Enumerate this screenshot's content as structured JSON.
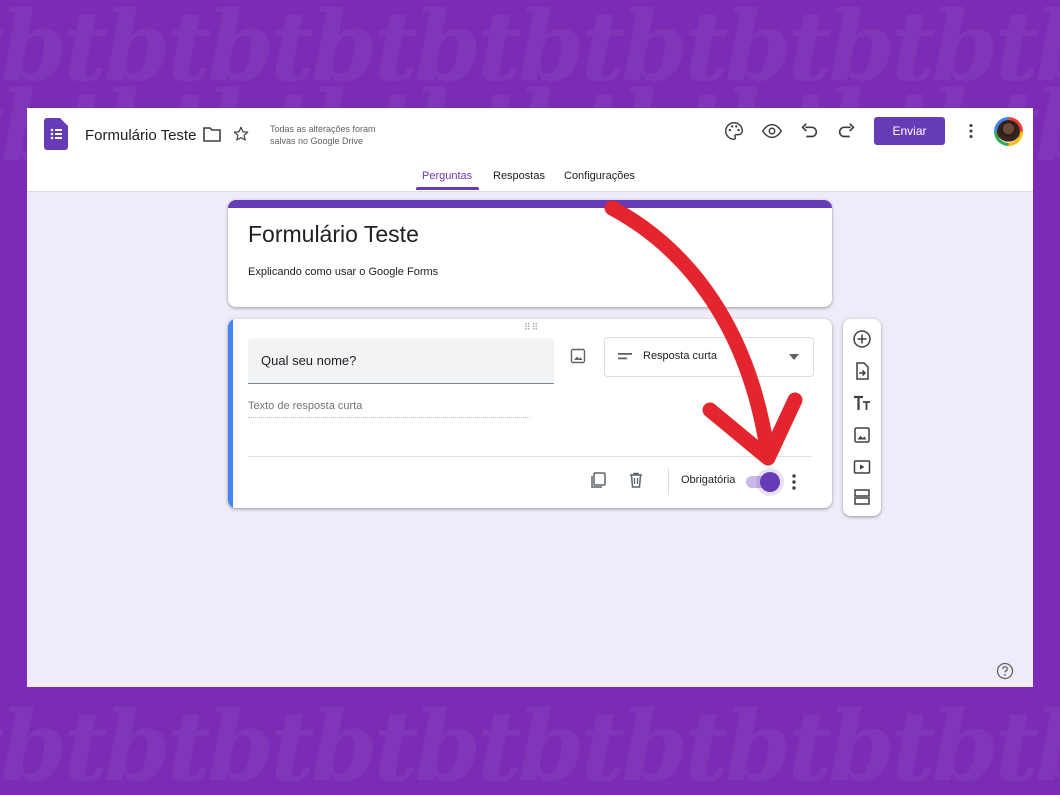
{
  "app": {
    "doc_title": "Formulário Teste",
    "save_status_line1": "Todas as alterações foram",
    "save_status_line2": "salvas no Google Drive",
    "send_label": "Enviar"
  },
  "tabs": [
    {
      "label": "Perguntas",
      "active": true
    },
    {
      "label": "Respostas",
      "active": false
    },
    {
      "label": "Configurações",
      "active": false
    }
  ],
  "form": {
    "title": "Formulário Teste",
    "description": "Explicando como usar o Google Forms"
  },
  "question": {
    "text": "Qual seu nome?",
    "type_label": "Resposta curta",
    "answer_hint": "Texto de resposta curta",
    "required_label": "Obrigatória",
    "required": true
  },
  "icons": {
    "header": [
      "forms-logo-icon",
      "folder-icon",
      "star-icon",
      "palette-icon",
      "preview-eye-icon",
      "undo-icon",
      "redo-icon",
      "more-vert-icon"
    ],
    "question_footer": [
      "duplicate-icon",
      "delete-icon",
      "more-vert-icon"
    ],
    "sidebar": [
      "add-question-icon",
      "import-questions-icon",
      "add-title-icon",
      "add-image-icon",
      "add-video-icon",
      "add-section-icon"
    ]
  },
  "colors": {
    "accent": "#673ab7",
    "question_strip": "#4285f4",
    "background": "#7b2bb5",
    "annotation_arrow": "#e5252d"
  }
}
